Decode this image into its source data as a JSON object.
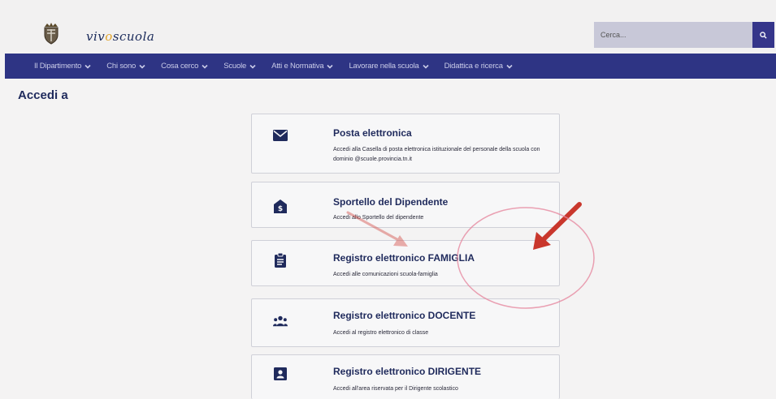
{
  "header": {
    "logo_text_prefix": "viv",
    "logo_text_accent": "o",
    "logo_text_suffix": "scuola",
    "search_placeholder": "Cerca...",
    "colors": {
      "nav_bg": "#2e3484",
      "search_btn": "#35358a",
      "search_bg": "#c8c8d8",
      "logo_accent": "#e0a32a"
    }
  },
  "nav": {
    "items": [
      {
        "label": "Il Dipartimento"
      },
      {
        "label": "Chi sono"
      },
      {
        "label": "Cosa cerco"
      },
      {
        "label": "Scuole"
      },
      {
        "label": "Atti e Normativa"
      },
      {
        "label": "Lavorare nella scuola"
      },
      {
        "label": "Didattica e ricerca"
      }
    ]
  },
  "page": {
    "title": "Accedi a"
  },
  "cards": [
    {
      "icon": "envelope-icon",
      "title": "Posta elettronica",
      "desc": "Accedi alla Casella di posta elettronica istituzionale del personale della scuola con dominio @scuole.provincia.tn.it"
    },
    {
      "icon": "dollar-house-icon",
      "title": "Sportello del Dipendente",
      "desc": "Accedi allo Sportello del dipendente"
    },
    {
      "icon": "clipboard-icon",
      "title": "Registro elettronico FAMIGLIA",
      "desc": "Accedi alle comunicazioni scuola-famiglia"
    },
    {
      "icon": "users-icon",
      "title": "Registro elettronico DOCENTE",
      "desc": "Accedi al registro elettronico di classe"
    },
    {
      "icon": "id-card-icon",
      "title": "Registro elettronico DIRIGENTE",
      "desc": "Accedi all'area riservata per il Dirigente scolastico"
    }
  ]
}
